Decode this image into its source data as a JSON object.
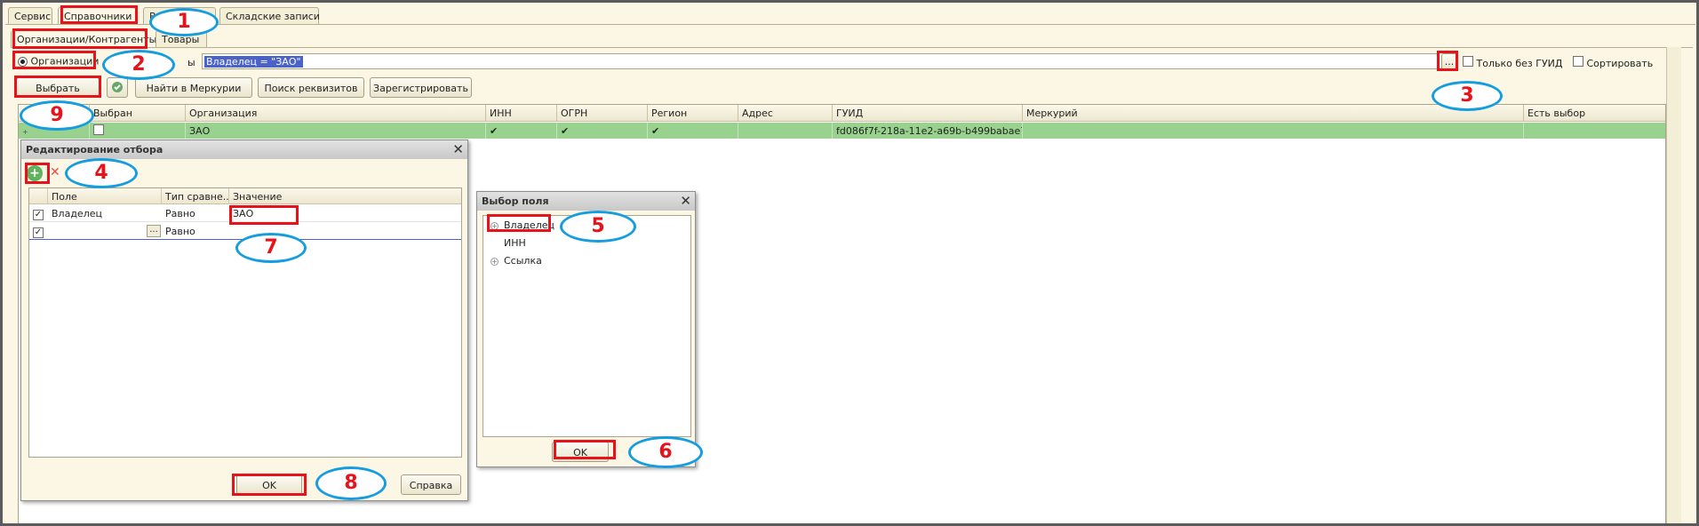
{
  "top_tabs": [
    {
      "label": "Сервис"
    },
    {
      "label": "Справочники"
    },
    {
      "label": "В"
    },
    {
      "label": "Складские записи"
    }
  ],
  "sub_tabs": [
    {
      "label": "Организации/Контрагенты"
    },
    {
      "label": "Товары"
    }
  ],
  "filter": {
    "radio_label": "Организации",
    "hidden_label": "ы",
    "value": "Владелец = \"ЗАО\"",
    "ellipsis": "...",
    "only_without_guid": "Только без ГУИД",
    "sort": "Сортировать"
  },
  "toolbar": {
    "select": "Выбрать",
    "find_mercury": "Найти в Меркурии",
    "search_requisites": "Поиск реквизитов",
    "register": "Зарегистрировать"
  },
  "table": {
    "columns": [
      "Выбран",
      "Организация",
      "ИНН",
      "ОГРН",
      "Регион",
      "Адрес",
      "ГУИД",
      "Меркурий",
      "Есть выбор"
    ],
    "rows": [
      {
        "org": "ЗАО",
        "inn": "✔",
        "ogrn": "✔",
        "region": "✔",
        "address": "",
        "guid": "fd086f7f-218a-11e2-a69b-b499babae7ea",
        "mercury": "",
        "has_choice": ""
      }
    ]
  },
  "filter_dialog": {
    "title": "Редактирование отбора",
    "columns": [
      "Поле",
      "Тип сравне...",
      "Значение"
    ],
    "rows": [
      {
        "field": "Владелец",
        "cmp": "Равно",
        "value": "ЗАО"
      },
      {
        "field": "",
        "cmp": "Равно",
        "value": "",
        "ellipsis": "..."
      }
    ],
    "ok": "OK",
    "help": "Справка"
  },
  "field_dialog": {
    "title": "Выбор поля",
    "items": [
      {
        "label": "Владелец"
      },
      {
        "label": "ИНН"
      },
      {
        "label": "Ссылка"
      }
    ],
    "ok": "OK"
  },
  "callouts": [
    "1",
    "2",
    "3",
    "4",
    "5",
    "6",
    "7",
    "8",
    "9"
  ],
  "colors": {
    "highlight_row": "#98d28e",
    "callout_border": "#169de0",
    "marker_red": "#e8121b",
    "selection": "#4b63c8"
  }
}
